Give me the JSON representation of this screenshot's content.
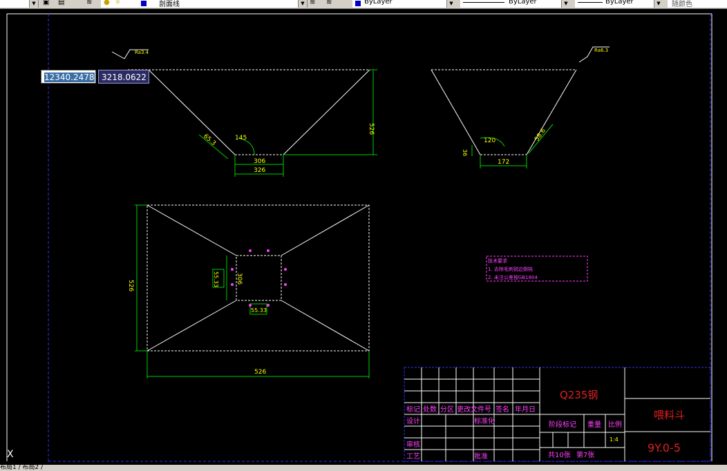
{
  "toolbar": {
    "layer_name": "剖面线",
    "color_value": "ByLayer",
    "linetype_value": "ByLayer",
    "lineweight_value": "ByLayer",
    "plotstyle_value": "随颜色"
  },
  "coords": {
    "x": "12340.2478",
    "y": "3218.0622"
  },
  "dims": {
    "ra_left": "Ra3.4",
    "ra_right": "Ra6.3",
    "height_526": "526",
    "slant_left": "65.3",
    "angle_left": "145",
    "inner_306": "306",
    "outer_326": "326",
    "angle_right": "120",
    "slant_right": "58.6",
    "right_small": "36",
    "right_bottom": "172",
    "plan_height": "526",
    "plan_width": "526",
    "sq_side": "306",
    "sq_left": "55.33",
    "sq_bottom": "55.33"
  },
  "notes": {
    "title": "技术要求",
    "line1": "1. 去除毛刺锐边倒钝",
    "line2": "2. 未注公差按GB1804"
  },
  "titleblock": {
    "material": "Q235钢",
    "part_name": "喂料斗",
    "drawing_no": "9Y.0-5",
    "col_mark": "标记",
    "col_count": "处数",
    "col_zone": "分区",
    "col_change": "更改文件号",
    "col_sign": "签名",
    "col_date": "年月日",
    "design": "设计",
    "standard": "标准化",
    "stage": "阶段标记",
    "weight": "重量",
    "scale": "比例",
    "scale_val": "1:4",
    "review": "审核",
    "craft": "工艺",
    "approve": "批准",
    "sheets": "共10张",
    "sheet_no": "第7张"
  },
  "ucs": "X",
  "tabs": "布局1 / 布局2 /"
}
